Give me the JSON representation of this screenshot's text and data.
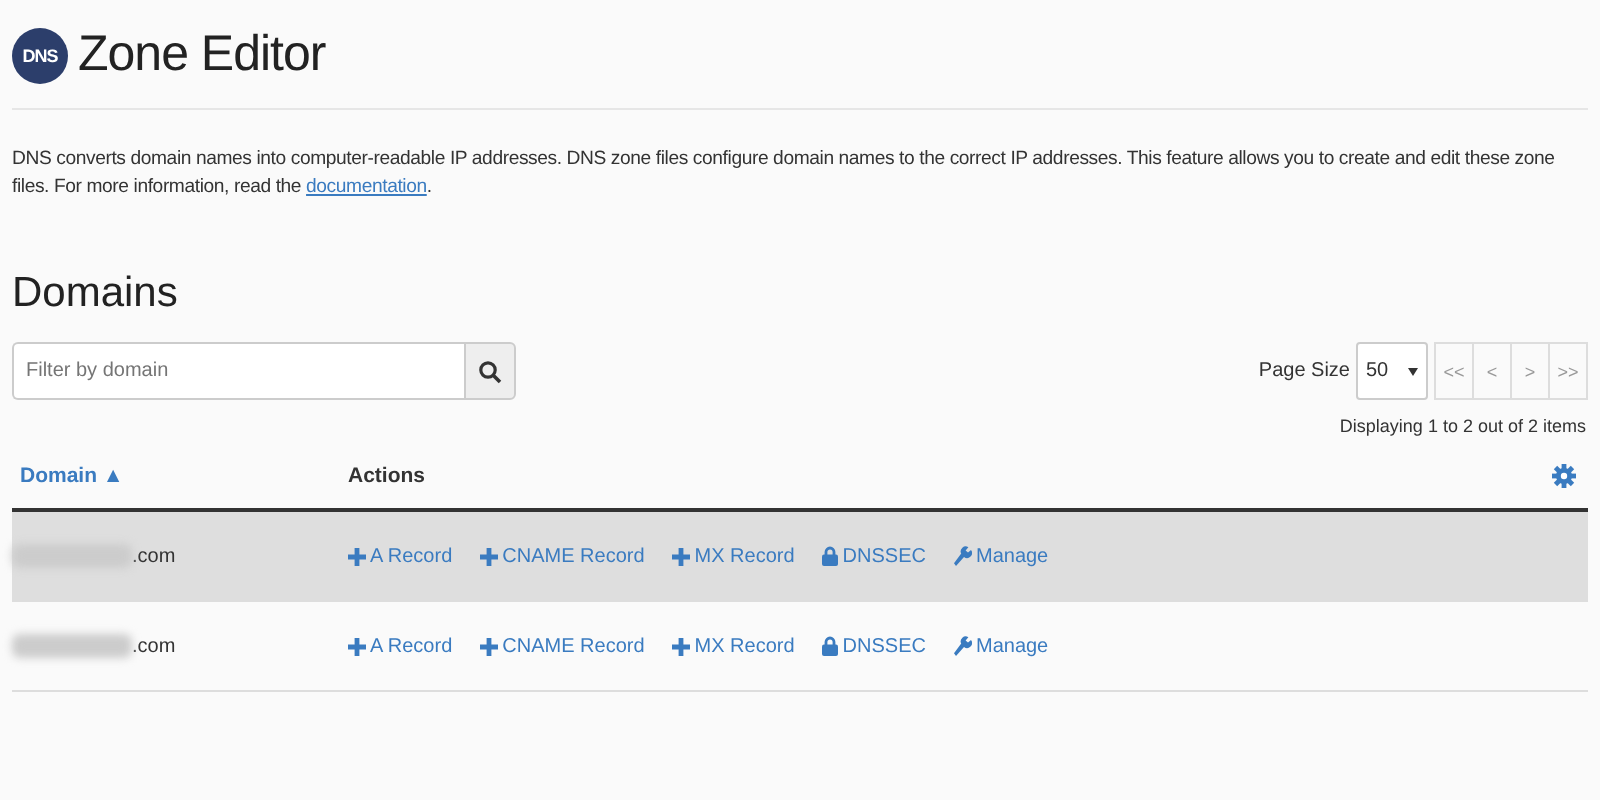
{
  "header": {
    "logo": "DNS",
    "title": "Zone Editor"
  },
  "description": {
    "text": "DNS converts domain names into computer-readable IP addresses. DNS zone files configure domain names to the correct IP addresses. This feature allows you to create and edit these zone files. For more information, read the",
    "link": "documentation",
    "after": "."
  },
  "section_title": "Domains",
  "search": {
    "placeholder": "Filter by domain"
  },
  "pagination": {
    "page_size_label": "Page Size",
    "page_size": "50",
    "buttons": [
      "<<",
      "<",
      ">",
      ">>"
    ],
    "summary": "Displaying 1 to 2 out of 2 items"
  },
  "table": {
    "columns": [
      {
        "label": "Domain",
        "sort": "▲"
      },
      {
        "label": "Actions"
      }
    ],
    "rows": [
      {
        "domain": ".com",
        "highlighted": true,
        "actions": [
          {
            "kind": "add",
            "label": "A Record"
          },
          {
            "kind": "add",
            "label": "CNAME Record"
          },
          {
            "kind": "add",
            "label": "MX Record"
          },
          {
            "kind": "lock",
            "label": "DNSSEC"
          },
          {
            "kind": "wrench",
            "label": "Manage"
          }
        ]
      },
      {
        "domain": ".com",
        "highlighted": false,
        "actions": [
          {
            "kind": "add",
            "label": "A Record"
          },
          {
            "kind": "add",
            "label": "CNAME Record"
          },
          {
            "kind": "add",
            "label": "MX Record"
          },
          {
            "kind": "lock",
            "label": "DNSSEC"
          },
          {
            "kind": "wrench",
            "label": "Manage"
          }
        ]
      }
    ]
  }
}
